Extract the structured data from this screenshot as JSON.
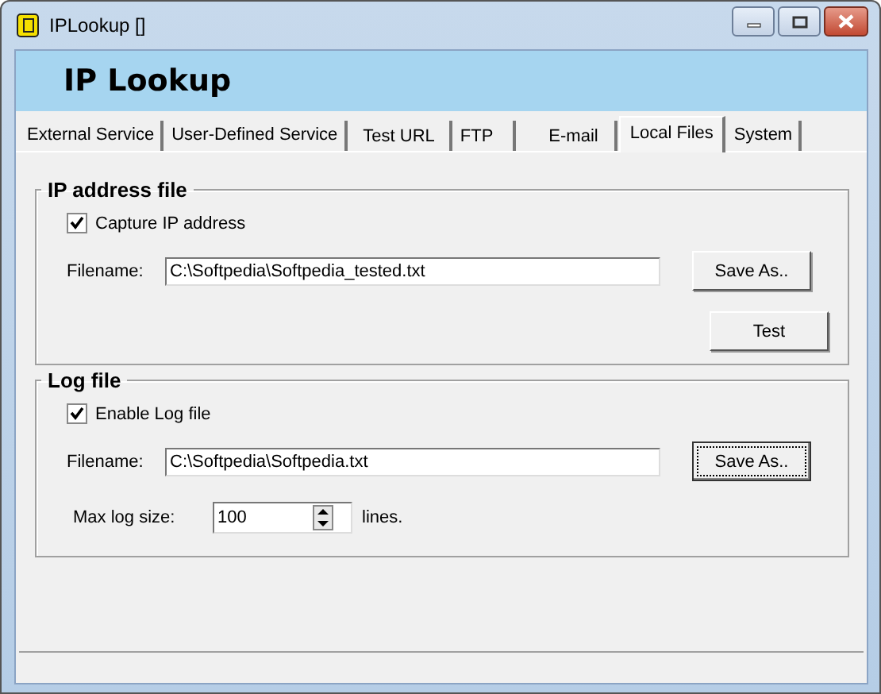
{
  "window": {
    "title": "IPLookup []"
  },
  "banner": {
    "title": "IP Lookup"
  },
  "tabs": [
    {
      "label": "External Service",
      "selected": false
    },
    {
      "label": "User-Defined Service",
      "selected": false
    },
    {
      "label": "Test URL",
      "selected": false
    },
    {
      "label": "FTP",
      "selected": false
    },
    {
      "label": "E-mail",
      "selected": false
    },
    {
      "label": "Local Files",
      "selected": true
    },
    {
      "label": "System",
      "selected": false
    }
  ],
  "ip_address_file": {
    "title": "IP address file",
    "checkbox": {
      "label": "Capture IP address",
      "checked": true
    },
    "filename_label": "Filename:",
    "filename": "C:\\Softpedia\\Softpedia_tested.txt",
    "save_button": {
      "label": "Save As..",
      "focused": false
    },
    "test_button": {
      "label": "Test",
      "focused": false
    }
  },
  "log_file": {
    "title": "Log file",
    "checkbox": {
      "label": "Enable Log file",
      "checked": true
    },
    "filename_label": "Filename:",
    "filename": "C:\\Softpedia\\Softpedia.txt",
    "save_button": {
      "label": "Save As..",
      "focused": true
    },
    "max_size_label": "Max log size:",
    "max_size": "100",
    "max_size_unit": "lines."
  }
}
